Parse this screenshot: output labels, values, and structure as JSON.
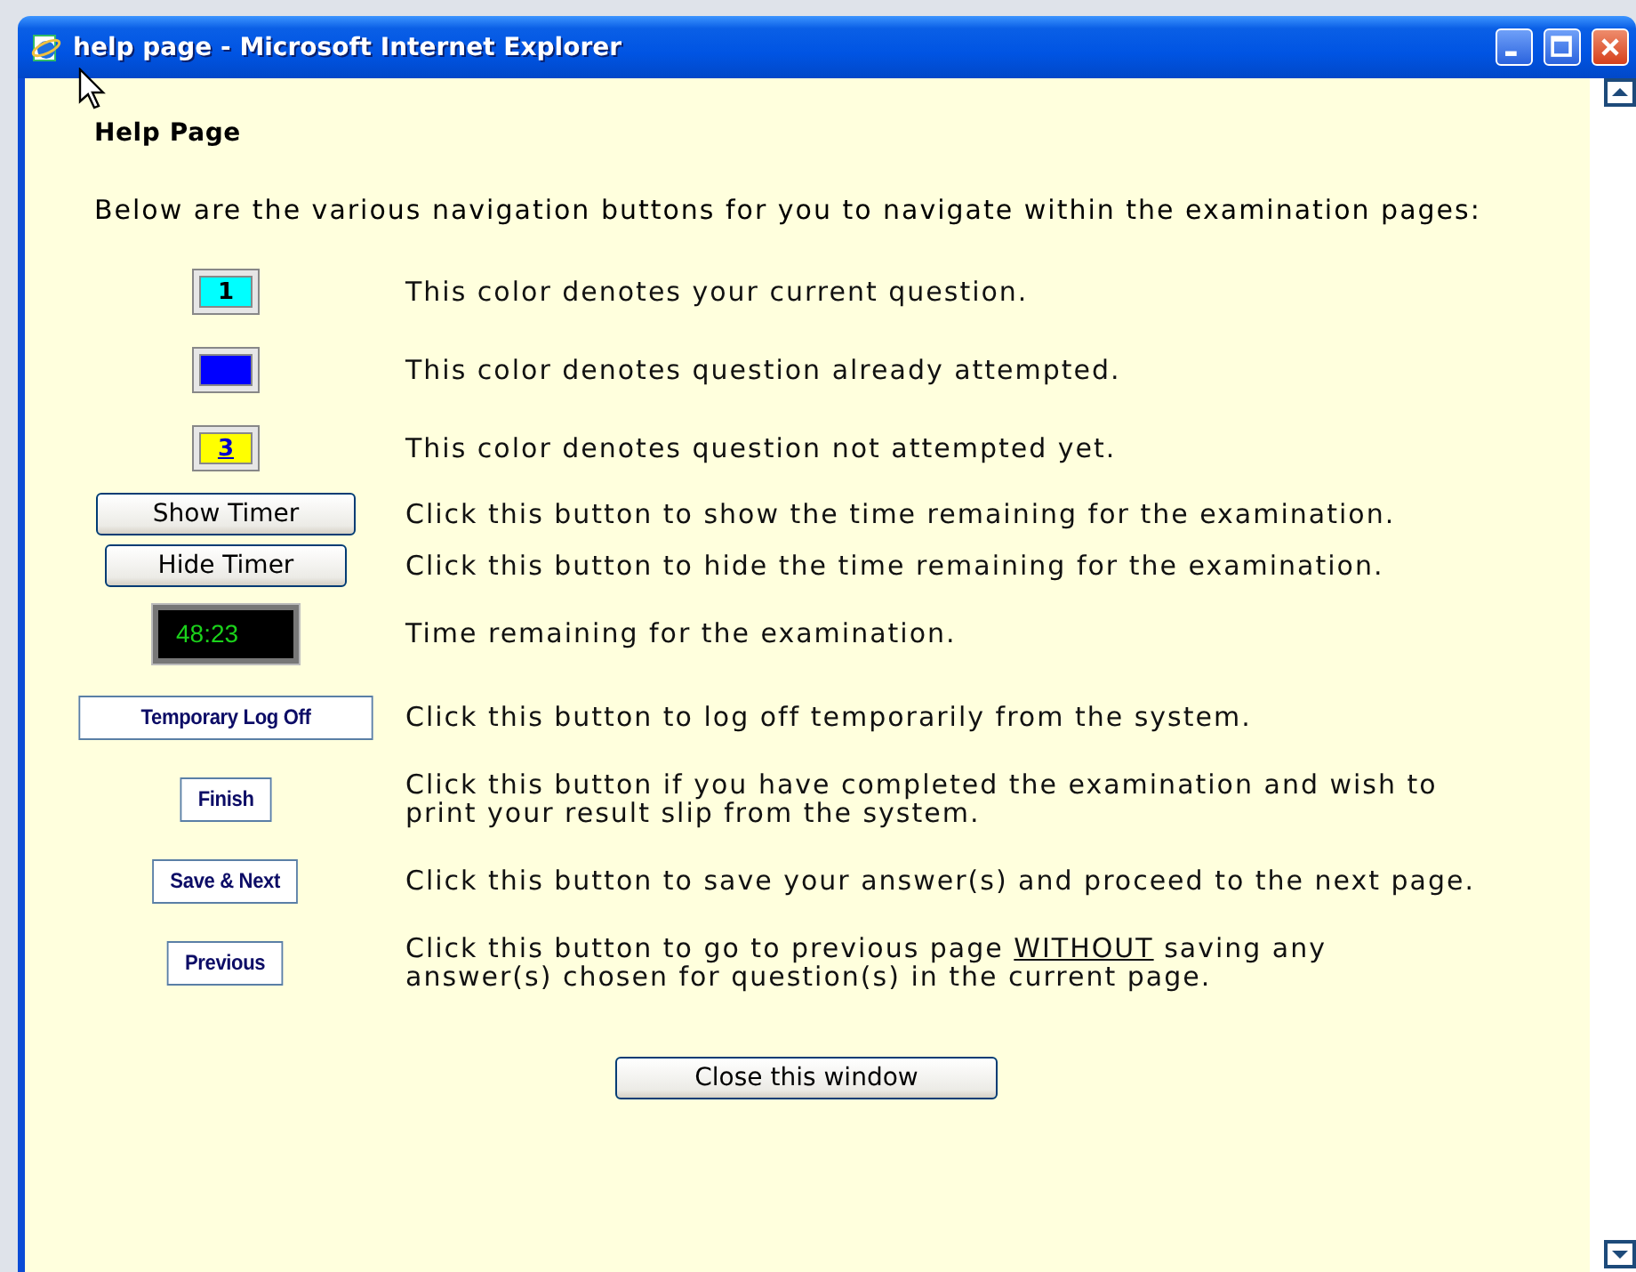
{
  "window": {
    "title": "help page - Microsoft Internet Explorer"
  },
  "heading": "Help Page",
  "intro": "Below are the various navigation buttons for you to navigate within the examination pages:",
  "items": [
    {
      "kind": "swatch",
      "color": "#00ffff",
      "label": "1",
      "link": false,
      "description": [
        {
          "text": "This color denotes your current question.",
          "underline": false
        }
      ]
    },
    {
      "kind": "swatch",
      "color": "#0000ff",
      "description": [
        {
          "text": "This color denotes question already attempted.",
          "underline": false
        }
      ]
    },
    {
      "kind": "swatch",
      "color": "#ffff00",
      "label": "3",
      "link": true,
      "description": [
        {
          "text": "This color denotes question not attempted yet.",
          "underline": false
        }
      ]
    },
    {
      "kind": "button",
      "label": "Show Timer",
      "description": [
        {
          "text": "Click this button to show the time remaining for the examination.",
          "underline": false
        }
      ]
    },
    {
      "kind": "button",
      "label": "Hide Timer",
      "description": [
        {
          "text": "Click this button to hide the time remaining for the examination.",
          "underline": false
        }
      ]
    },
    {
      "kind": "timer",
      "label": "48:23",
      "description": [
        {
          "text": "Time remaining for the examination.",
          "underline": false
        }
      ]
    },
    {
      "kind": "nav",
      "label": "Temporary Log Off",
      "description": [
        {
          "text": "Click this button to log off temporarily from the system.",
          "underline": false
        }
      ]
    },
    {
      "kind": "nav",
      "label": "Finish",
      "description": [
        {
          "text": "Click this button if you have completed the examination and wish to print your result slip from the system.",
          "underline": false
        }
      ]
    },
    {
      "kind": "nav",
      "label": "Save & Next",
      "description": [
        {
          "text": "Click this button to save your answer(s) and proceed to the next page.",
          "underline": false
        }
      ]
    },
    {
      "kind": "nav",
      "label": "Previous",
      "description": [
        {
          "text": "Click this button to go to previous page ",
          "underline": false
        },
        {
          "text": "WITHOUT",
          "underline": true
        },
        {
          "text": " saving any answer(s) chosen for question(s) in the current page.",
          "underline": false
        }
      ]
    }
  ],
  "close_button": "Close this window"
}
